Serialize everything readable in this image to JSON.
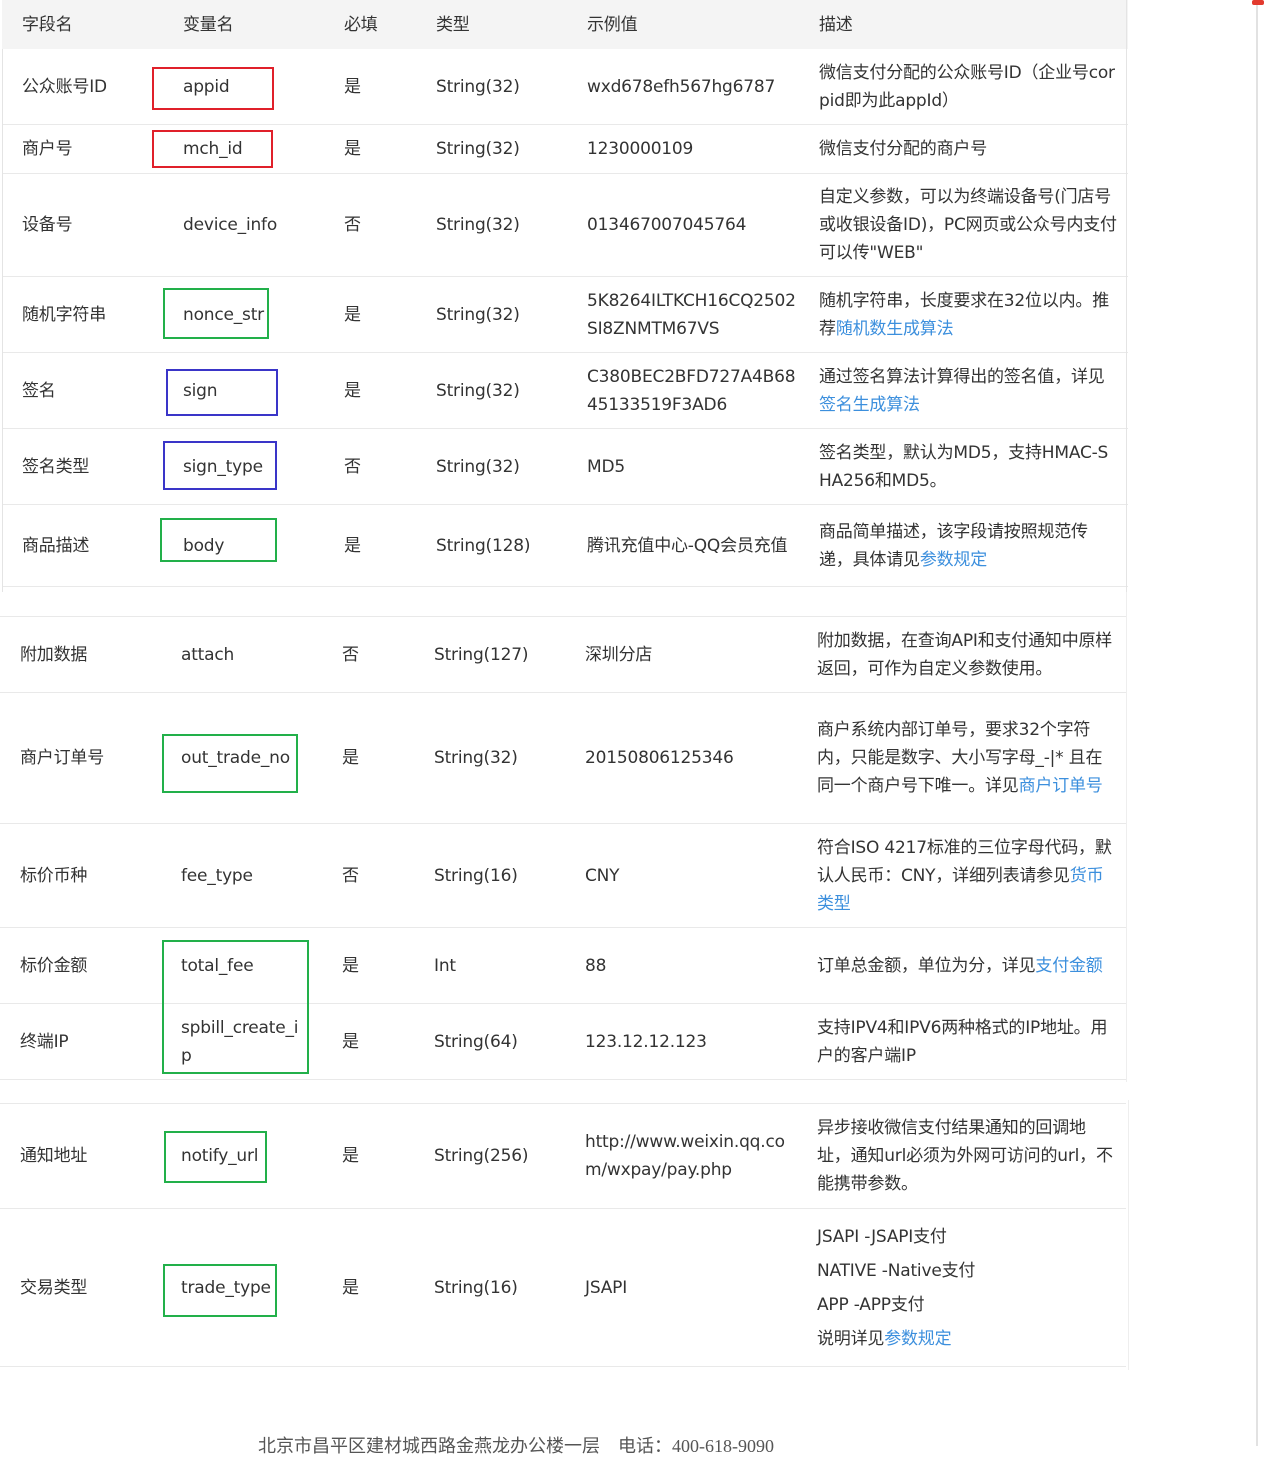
{
  "header": {
    "field": "字段名",
    "var": "变量名",
    "required": "必填",
    "type": "类型",
    "example": "示例值",
    "desc": "描述"
  },
  "rows": [
    {
      "field": "公众账号ID",
      "var": "appid",
      "req": "是",
      "type": "String(32)",
      "ex": "wxd678efh567hg6787",
      "desc": "微信支付分配的公众账号ID（企业号corpid即为此appId）",
      "link": ""
    },
    {
      "field": "商户号",
      "var": "mch_id",
      "req": "是",
      "type": "String(32)",
      "ex": "1230000109",
      "desc": "微信支付分配的商户号",
      "link": ""
    },
    {
      "field": "设备号",
      "var": "device_info",
      "req": "否",
      "type": "String(32)",
      "ex": "013467007045764",
      "desc": "自定义参数，可以为终端设备号(门店号或收银设备ID)，PC网页或公众号内支付可以传\"WEB\"",
      "link": ""
    },
    {
      "field": "随机字符串",
      "var": "nonce_str",
      "req": "是",
      "type": "String(32)",
      "ex": "5K8264ILTKCH16CQ2502SI8ZNMTM67VS",
      "desc": "随机字符串，长度要求在32位以内。推荐",
      "link": "随机数生成算法"
    },
    {
      "field": "签名",
      "var": "sign",
      "req": "是",
      "type": "String(32)",
      "ex": "C380BEC2BFD727A4B6845133519F3AD6",
      "desc": "通过签名算法计算得出的签名值，详见",
      "link": "签名生成算法"
    },
    {
      "field": "签名类型",
      "var": "sign_type",
      "req": "否",
      "type": "String(32)",
      "ex": "MD5",
      "desc": "签名类型，默认为MD5，支持HMAC-SHA256和MD5。",
      "link": ""
    },
    {
      "field": "商品描述",
      "var": "body",
      "req": "是",
      "type": "String(128)",
      "ex": "腾讯充值中心-QQ会员充值",
      "desc": "商品简单描述，该字段请按照规范传递，具体请见",
      "link": "参数规定"
    },
    {
      "field": "附加数据",
      "var": "attach",
      "req": "否",
      "type": "String(127)",
      "ex": "深圳分店",
      "desc": "附加数据，在查询API和支付通知中原样返回，可作为自定义参数使用。",
      "link": ""
    },
    {
      "field": "商户订单号",
      "var": "out_trade_no",
      "req": "是",
      "type": "String(32)",
      "ex": "20150806125346",
      "desc": "商户系统内部订单号，要求32个字符内，只能是数字、大小写字母_-|* 且在同一个商户号下唯一。详见",
      "link": "商户订单号"
    },
    {
      "field": "标价币种",
      "var": "fee_type",
      "req": "否",
      "type": "String(16)",
      "ex": "CNY",
      "desc": "符合ISO 4217标准的三位字母代码，默认人民币：CNY，详细列表请参见",
      "link": "货币类型"
    },
    {
      "field": "标价金额",
      "var": "total_fee",
      "req": "是",
      "type": "Int",
      "ex": "88",
      "desc": "订单总金额，单位为分，详见",
      "link": "支付金额"
    },
    {
      "field": "终端IP",
      "var": "spbill_create_ip",
      "req": "是",
      "type": "String(64)",
      "ex": "123.12.12.123",
      "desc": "支持IPV4和IPV6两种格式的IP地址。用户的客户端IP",
      "link": ""
    },
    {
      "field": "通知地址",
      "var": "notify_url",
      "req": "是",
      "type": "String(256)",
      "ex": "http://www.weixin.qq.com/wxpay/pay.php",
      "desc": "异步接收微信支付结果通知的回调地址，通知url必须为外网可访问的url，不能携带参数。",
      "link": ""
    },
    {
      "field": "交易类型",
      "var": "trade_type",
      "req": "是",
      "type": "String(16)",
      "ex": "JSAPI",
      "desc": "",
      "link": "参数规定",
      "desc_lines": [
        "JSAPI -JSAPI支付",
        "NATIVE -Native支付",
        "APP -APP支付",
        "说明详见"
      ]
    }
  ],
  "footer": "北京市昌平区建材城西路金燕龙办公楼一层　电话：400-618-9090"
}
